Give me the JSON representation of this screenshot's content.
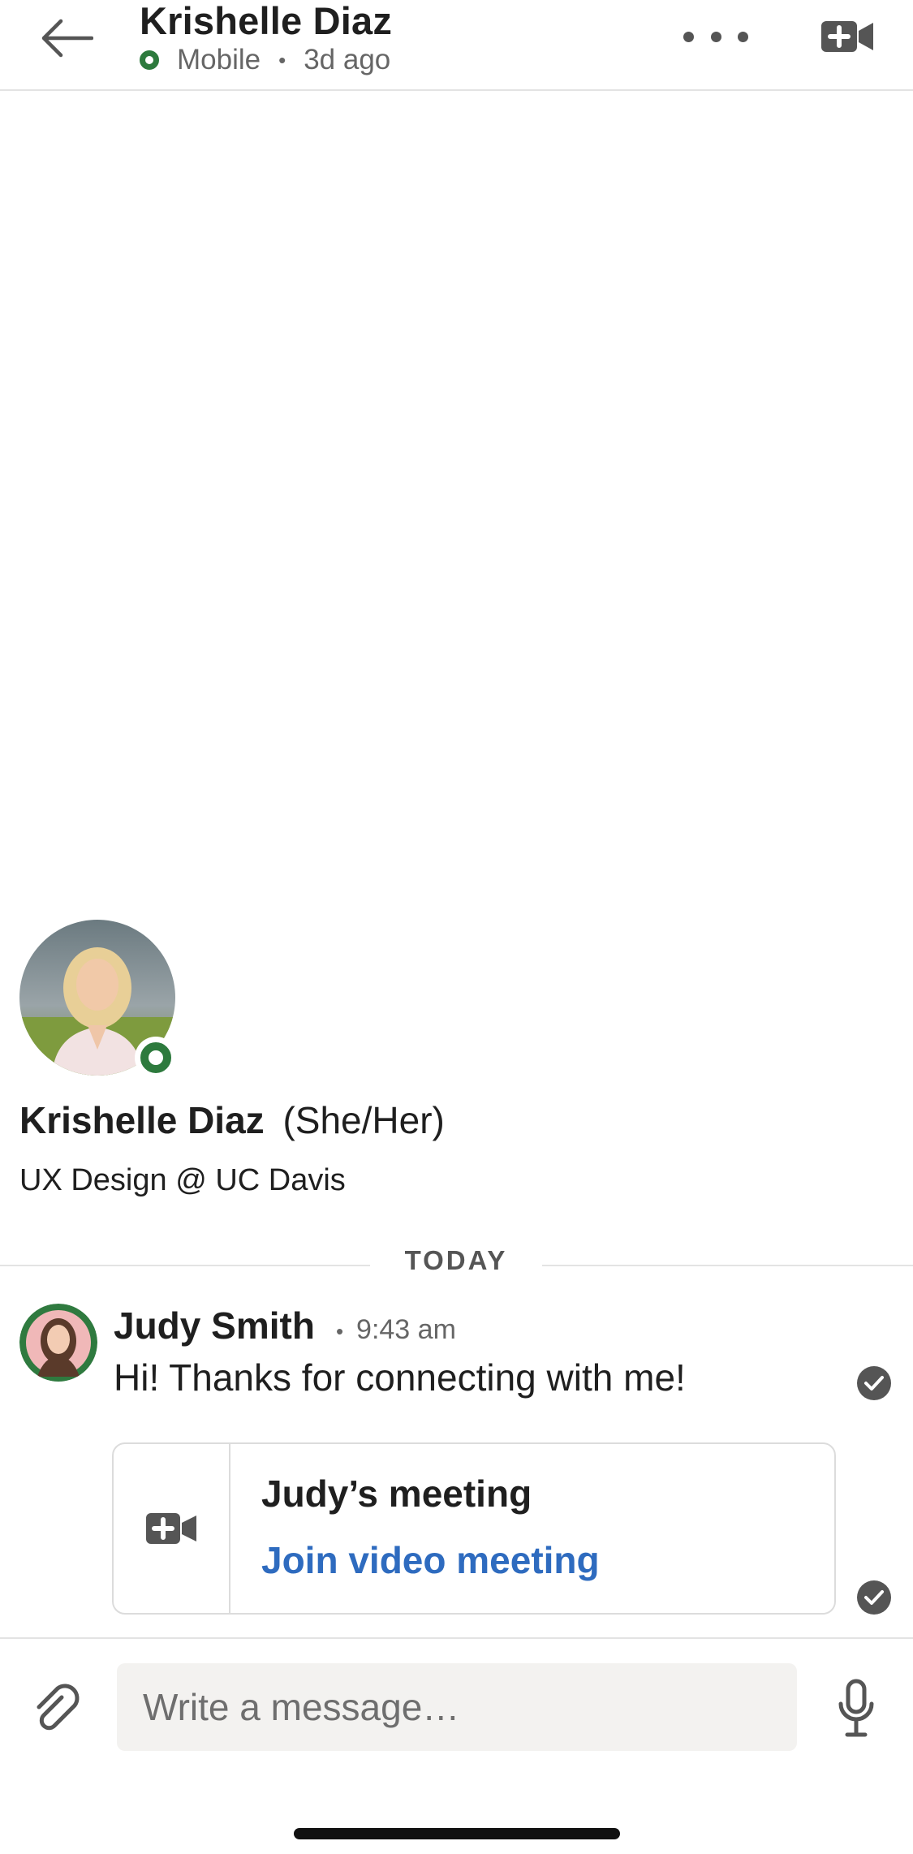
{
  "header": {
    "contact_name": "Krishelle Diaz",
    "presence_device": "Mobile",
    "separator": "•",
    "last_active": "3d ago",
    "icons": {
      "back": "back-arrow-icon",
      "more": "more-horizontal-icon",
      "video": "video-call-icon"
    }
  },
  "profile": {
    "name": "Krishelle Diaz",
    "pronouns": "(She/Her)",
    "headline": "UX Design @ UC Davis",
    "online": true
  },
  "divider": {
    "label": "TODAY"
  },
  "messages": [
    {
      "sender": "Judy Smith",
      "separator": "•",
      "time": "9:43 am",
      "text": "Hi! Thanks for connecting with me!",
      "read": true
    }
  ],
  "meeting_card": {
    "title": "Judy’s meeting",
    "link_label": "Join video meeting",
    "read": true
  },
  "composer": {
    "placeholder": "Write a message…",
    "value": "",
    "icons": {
      "attach": "paperclip-icon",
      "mic": "microphone-icon"
    }
  },
  "colors": {
    "presence_green": "#2d7a3d",
    "link_blue": "#2e6bbf",
    "input_bg": "#f3f2f0"
  }
}
